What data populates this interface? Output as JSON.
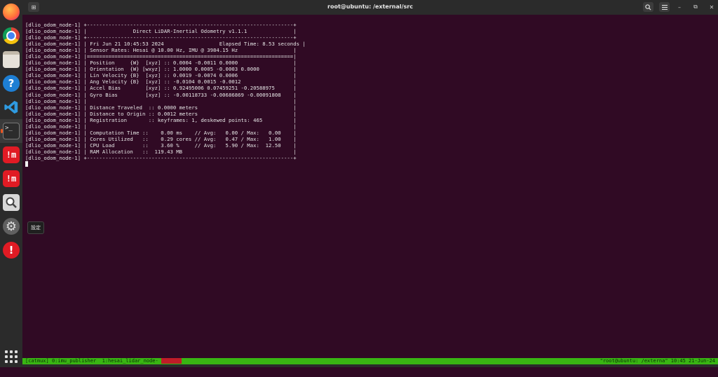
{
  "window": {
    "title": "root@ubuntu: /external/src"
  },
  "titlebar": {
    "newtab_icon": "new-tab-icon",
    "search_icon": "search-icon",
    "menu_icon": "hamburger-menu-icon"
  },
  "dock": {
    "items": [
      {
        "name": "firefox",
        "icon": "firefox-icon"
      },
      {
        "name": "chrome",
        "icon": "chrome-icon"
      },
      {
        "name": "files",
        "icon": "files-icon"
      },
      {
        "name": "help",
        "icon": "help-icon",
        "glyph": "?"
      },
      {
        "name": "vscode",
        "icon": "vscode-icon"
      },
      {
        "name": "terminal",
        "icon": "terminal-icon",
        "glyph": ">_"
      },
      {
        "name": "app-red-1",
        "icon": "red-app-icon",
        "glyph": "!m"
      },
      {
        "name": "app-red-2",
        "icon": "red-app-icon",
        "glyph": "!m"
      },
      {
        "name": "image-viewer",
        "icon": "magnifier-icon"
      },
      {
        "name": "settings",
        "icon": "gear-icon",
        "glyph": "⚙"
      },
      {
        "name": "software-updater",
        "icon": "alert-icon",
        "glyph": "!"
      }
    ],
    "tooltip": "設定",
    "show_apps_icon": "show-apps-grid-icon"
  },
  "terminal": {
    "lines": [
      "[dlio_odom_node-1] +-------------------------------------------------------------------+",
      "[dlio_odom_node-1] |               Direct LiDAR-Inertial Odometry v1.1.1               |",
      "[dlio_odom_node-1] +-------------------------------------------------------------------+",
      "[dlio_odom_node-1] | Fri Jun 21 10:45:53 2024                  Elapsed Time: 8.53 seconds |",
      "[dlio_odom_node-1] | Sensor Rates: Hesai @ 10.00 Hz, IMU @ 3984.15 Hz                  |",
      "[dlio_odom_node-1] |===================================================================|",
      "[dlio_odom_node-1] | Position     {W}  [xyz] :: 0.0004 -0.0011 0.0000                  |",
      "[dlio_odom_node-1] | Orientation  {W} [wxyz] :: 1.0000 0.0005 -0.0003 0.0000           |",
      "[dlio_odom_node-1] | Lin Velocity {B}  [xyz] :: 0.0019 -0.0074 0.0006                  |",
      "[dlio_odom_node-1] | Ang Velocity {B}  [xyz] :: -0.0104 0.0015 -0.0012                 |",
      "[dlio_odom_node-1] | Accel Bias        [xyz] :: 0.92495006 0.07459251 -0.20588975      |",
      "[dlio_odom_node-1] | Gyro Bias         [xyz] :: -0.00118733 -0.00686869 -0.00091808    |",
      "[dlio_odom_node-1] |                                                                   |",
      "[dlio_odom_node-1] | Distance Traveled  :: 0.0000 meters                               |",
      "[dlio_odom_node-1] | Distance to Origin :: 0.0012 meters                               |",
      "[dlio_odom_node-1] | Registration       :: keyframes: 1, deskewed points: 465          |",
      "[dlio_odom_node-1] |                                                                   |",
      "[dlio_odom_node-1] | Computation Time ::    0.00 ms    // Avg:   0.00 / Max:   0.00    |",
      "[dlio_odom_node-1] | Cores Utilized   ::    0.29 cores // Avg:   0.47 / Max:   1.00    |",
      "[dlio_odom_node-1] | CPU Load         ::    3.60 %     // Avg:   5.90 / Max:  12.50    |",
      "[dlio_odom_node-1] | RAM Allocation   ::  119.43 MB                                    |",
      "[dlio_odom_node-1] +-------------------------------------------------------------------+"
    ]
  },
  "tmux": {
    "session": "[catmux] ",
    "windows": [
      "0:imu_publisher",
      "1:hesai_lidar_node-",
      "2:dlio"
    ],
    "status_right": "\"root@ubuntu: /externa\" 10:45 21-Jun-24",
    "color": "#39b513"
  }
}
